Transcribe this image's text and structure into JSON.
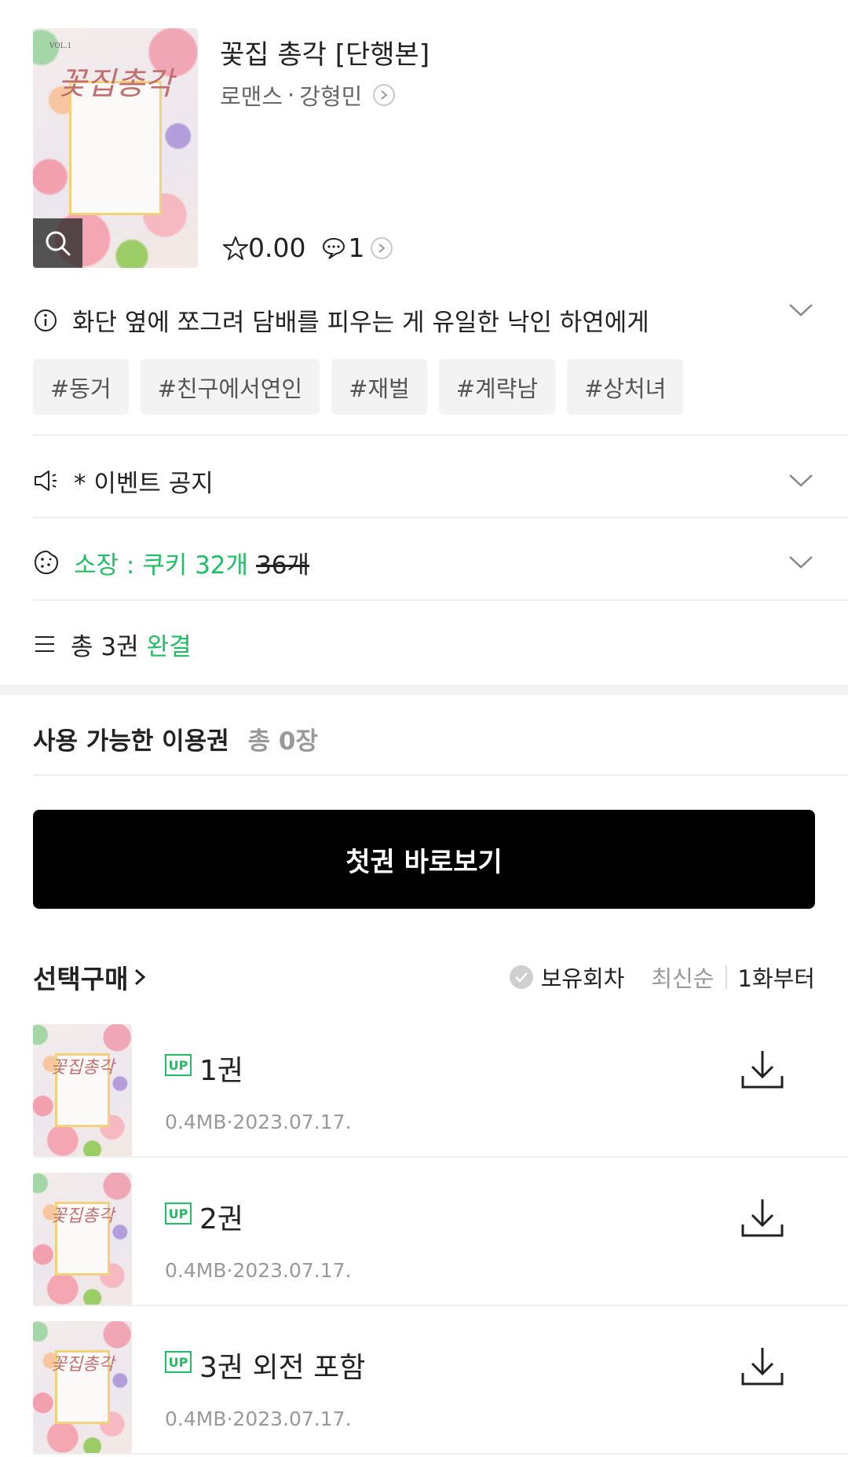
{
  "book": {
    "title": "꽃집 총각 [단행본]",
    "genre": "로맨스",
    "dot": "·",
    "author": "강형민",
    "rating": "0.00",
    "comments": "1",
    "cover_title": "꽃집총각",
    "cover_vol": "VOL.1"
  },
  "synopsis": "화단 옆에 쪼그려 담배를 피우는 게 유일한 낙인 하연에게",
  "tags": [
    "#동거",
    "#친구에서연인",
    "#재벌",
    "#계략남",
    "#상처녀"
  ],
  "notice": {
    "label": "* 이벤트 공지"
  },
  "price": {
    "label": "소장 : 쿠키 32개",
    "original": "36개"
  },
  "volumes": {
    "label": "총 3권",
    "status": "완결"
  },
  "tickets": {
    "title": "사용 가능한 이용권",
    "count": "총 0장"
  },
  "read_button": "첫권 바로보기",
  "selection": {
    "title": "선택구매",
    "owned_label": "보유회차",
    "sort_latest": "최신순",
    "sort_first": "1화부터"
  },
  "episodes": [
    {
      "badge": "UP",
      "name": "1권",
      "info": "0.4MB·2023.07.17."
    },
    {
      "badge": "UP",
      "name": "2권",
      "info": "0.4MB·2023.07.17."
    },
    {
      "badge": "UP",
      "name": "3권 외전 포함",
      "info": "0.4MB·2023.07.17."
    }
  ],
  "colors": {
    "accent_green": "#1fbf63",
    "button_black": "#000000"
  }
}
